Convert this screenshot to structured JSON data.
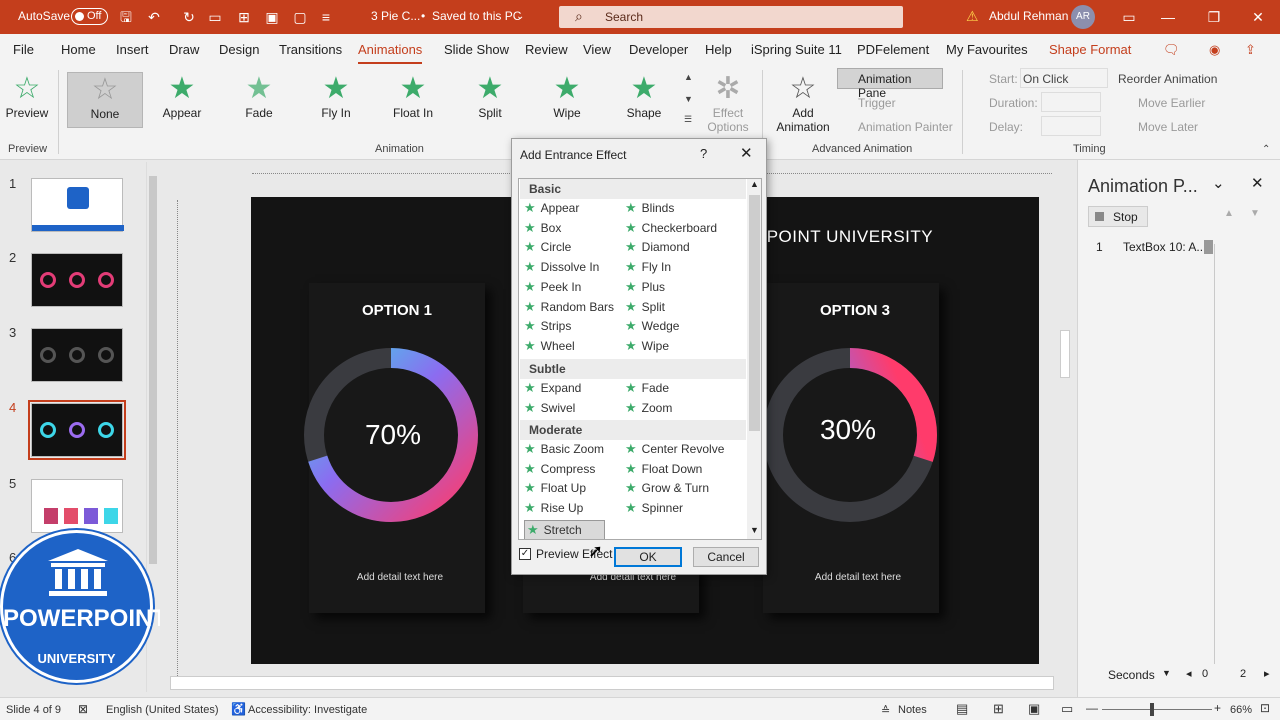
{
  "titlebar": {
    "autosave_label": "AutoSave",
    "autosave_state": "Off",
    "doc_title": "3 Pie C...",
    "save_status": "Saved to this PC",
    "search_placeholder": "Search",
    "user_name": "Abdul Rehman",
    "user_initials": "AR"
  },
  "menu": {
    "tabs": [
      "File",
      "Home",
      "Insert",
      "Draw",
      "Design",
      "Transitions",
      "Animations",
      "Slide Show",
      "Review",
      "View",
      "Developer",
      "Help",
      "iSpring Suite 11",
      "PDFelement",
      "My Favourites",
      "Shape Format"
    ],
    "active": "Animations"
  },
  "ribbon": {
    "preview_label": "Preview",
    "preview_group": "Preview",
    "animation_group": "Animation",
    "effects": [
      "None",
      "Appear",
      "Fade",
      "Fly In",
      "Float In",
      "Split",
      "Wipe",
      "Shape"
    ],
    "effect_options_line1": "Effect",
    "effect_options_line2": "Options",
    "add_animation_line1": "Add",
    "add_animation_line2": "Animation",
    "advanced_group": "Advanced Animation",
    "animation_pane": "Animation Pane",
    "trigger": "Trigger",
    "animation_painter": "Animation Painter",
    "timing_group": "Timing",
    "start_label": "Start:",
    "start_value": "On Click",
    "duration_label": "Duration:",
    "delay_label": "Delay:",
    "reorder": "Reorder Animation",
    "move_earlier": "Move Earlier",
    "move_later": "Move Later"
  },
  "thumbnails": [
    "1",
    "2",
    "3",
    "4",
    "5",
    "6"
  ],
  "slide": {
    "watermark": "POWERPOINT UNIVERSITY",
    "option1": "OPTION 1",
    "option3": "OPTION 3",
    "pct1": "70%",
    "pct3": "30%",
    "detail1": "Add detail text here",
    "detail2": "Add detail text here",
    "detail3": "Add detail text here"
  },
  "logo": {
    "line1": "POWERPOINT",
    "line2": "UNIVERSITY"
  },
  "dialog": {
    "title": "Add Entrance Effect",
    "help": "?",
    "categories": [
      "Basic",
      "Subtle",
      "Moderate"
    ],
    "basic_left": [
      "Appear",
      "Box",
      "Circle",
      "Dissolve In",
      "Peek In",
      "Random Bars",
      "Strips",
      "Wheel"
    ],
    "basic_right": [
      "Blinds",
      "Checkerboard",
      "Diamond",
      "Fly In",
      "Plus",
      "Split",
      "Wedge",
      "Wipe"
    ],
    "subtle_left": [
      "Expand",
      "Swivel"
    ],
    "subtle_right": [
      "Fade",
      "Zoom"
    ],
    "moderate_left": [
      "Basic Zoom",
      "Compress",
      "Float Up",
      "Rise Up",
      "Stretch"
    ],
    "moderate_right": [
      "Center Revolve",
      "Float Down",
      "Grow & Turn",
      "Spinner"
    ],
    "selected": "Stretch",
    "preview_effect": "Preview Effect",
    "preview_checked": true,
    "ok": "OK",
    "cancel": "Cancel"
  },
  "animpane": {
    "title": "Animation P...",
    "stop": "Stop",
    "item_number": "1",
    "item_label": "TextBox 10: A...",
    "seconds": "Seconds",
    "timeline_start": "0",
    "timeline_end": "2"
  },
  "status": {
    "slide_info": "Slide 4 of 9",
    "language": "English (United States)",
    "accessibility": "Accessibility: Investigate",
    "notes": "Notes",
    "zoom": "66%"
  },
  "colors": {
    "accent": "#c43e1c",
    "star": "#3dab6b",
    "slide_bg": "#141414",
    "donut_pink": "#ff3b6b",
    "donut_cyan": "#3dd6e8"
  }
}
